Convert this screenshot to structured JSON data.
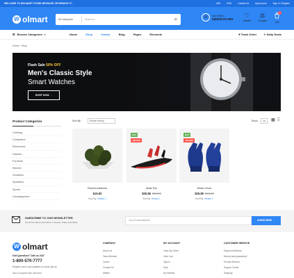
{
  "topbar": {
    "welcome": "WELCOME TO WOLMART STORE MESSAGE OR REMOVE IT!",
    "links": [
      "USD",
      "ENG",
      "Contact Us",
      "My Account",
      "Sign In / Register"
    ]
  },
  "header": {
    "logo": "olmart",
    "logo_mark": "W",
    "search_category": "All Categories",
    "search_placeholder": "Search in...",
    "call_label": "Live Chat or :",
    "call_number": "0(800)123-456",
    "icons": [
      {
        "label": "Wishlist",
        "icon": "heart-icon",
        "glyph": "♡"
      },
      {
        "label": "Compare",
        "icon": "compare-icon",
        "glyph": "⚖"
      },
      {
        "label": "Cart",
        "icon": "cart-icon",
        "glyph": "🛍",
        "count": "0"
      }
    ]
  },
  "nav": {
    "browse": "Browse Categories",
    "menu": [
      "Home",
      "Shop",
      "Vendor",
      "Blog",
      "Pages",
      "Elements"
    ],
    "active_index": 1,
    "right": [
      "Track Order",
      "Daily Deals"
    ]
  },
  "breadcrumb": "Home  ›  Shop",
  "hero": {
    "flash": "Flash Sale",
    "flash_pct": "50% OFF",
    "title1": "Men's Classic Style",
    "title2": "Smart Watches",
    "button": "SHOP NOW  →"
  },
  "sidebar": {
    "title": "Product Categories",
    "categories": [
      "Clothing",
      "Computers",
      "Electronics",
      "Fashion",
      "Furniture",
      "Kitchen",
      "Sneakers",
      "Speakers",
      "Sports",
      "Uncategorized"
    ]
  },
  "toolbar": {
    "sort_label": "Sort By :",
    "sort_value": "Default sorting",
    "show_label": "Show :",
    "show_value": "12"
  },
  "products": [
    {
      "name": "Packed Avitamins",
      "price": "$19.50",
      "old": "",
      "sold_label": "Sold By:",
      "vendor": "Vendor 1",
      "hot": "",
      "off": ""
    },
    {
      "name": "Skate Pan",
      "price": "$25.85",
      "old": "$28.00",
      "sold_label": "Sold By:",
      "vendor": "Vendor 1",
      "hot": "HOT",
      "off": "-9% OFF"
    },
    {
      "name": "Winter Glove",
      "price": "$25.85",
      "old": "$28.00",
      "sold_label": "Sold By:",
      "vendor": "Vendor 1",
      "hot": "HOT",
      "off": "-9% OFF"
    }
  ],
  "newsletter": {
    "title": "SUBSCRIBE TO OUR NEWSLETTER",
    "subtitle": "Get all the latest information on Events, Sales and Offers.",
    "placeholder": "Your E-mail Address",
    "button": "SUBSCRIBE  →"
  },
  "footer": {
    "question": "Got Question? Call us 24/7",
    "phone": "1-800-570-7777",
    "addr1": "Register now to get updates on pronot get up",
    "addr2": "icon & coupons ster now toon.",
    "columns": [
      {
        "title": "COMPANY",
        "items": [
          "About Us",
          "Team Member",
          "Career",
          "Contact Us",
          "Affilate"
        ]
      },
      {
        "title": "MY ACCOUNT",
        "items": [
          "Track My Order",
          "View Cart",
          "Sign In",
          "Help",
          "My Wishlist"
        ]
      },
      {
        "title": "CUSTOMER SERVICE",
        "items": [
          "Payment Methods",
          "Money-back guarantee!",
          "Product Returns",
          "Support Center",
          "Shipping"
        ]
      }
    ]
  }
}
